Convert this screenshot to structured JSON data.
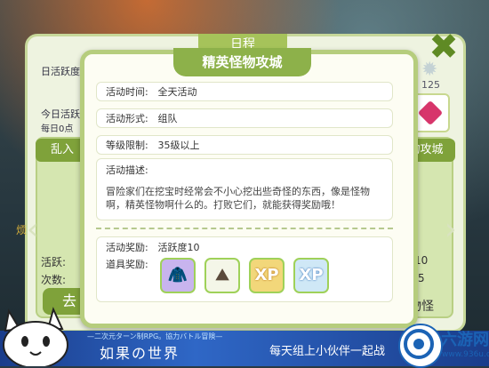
{
  "back_screen": {
    "title": "日程",
    "daily_active_label": "日活跃度",
    "today_active_label": "今日活跃",
    "daily_reset_label": "每日0点",
    "active_value": "125",
    "left_tab": "乱入",
    "right_tab": "物攻城",
    "active_row_label": "活跃:",
    "count_row_label": "次数:",
    "left_col_progress_1": "/10",
    "left_col_progress_2": "/5",
    "go_button": "去",
    "right_tail": "物怪",
    "side_char": "烦"
  },
  "modal": {
    "title": "精英怪物攻城",
    "rows": [
      {
        "label": "活动时间:",
        "value": "全天活动"
      },
      {
        "label": "活动形式:",
        "value": "组队"
      },
      {
        "label": "等级限制:",
        "value": "35级以上"
      }
    ],
    "description_label": "活动描述:",
    "description": "冒险家们在挖宝时经常会不小心挖出些奇怪的东西，像是怪物啊，精英怪物啊什么的。打败它们，就能获得奖励哦！",
    "reward_label": "活动奖励:",
    "reward_value": "活跃度10",
    "item_label": "道具奖励:",
    "items": [
      {
        "icon": "purple-cloak-icon",
        "glyph": "🧥"
      },
      {
        "icon": "rock-armor-icon",
        "glyph": "⛰"
      },
      {
        "icon": "xp-orange-icon",
        "glyph": "XP"
      },
      {
        "icon": "xp-blue-icon",
        "glyph": "XP"
      }
    ]
  },
  "banner": {
    "subtitle": "—二次元ターン制RPG。協力バトル冒険—",
    "title": "如果の世界",
    "slogan": "每天组上小伙伴一起战",
    "logo_text": "六游网",
    "logo_url": "www.936u.com"
  },
  "colors": {
    "accent_green": "#8db14a",
    "panel_border": "#b6cd7d",
    "banner_blue": "#2f67c6"
  }
}
